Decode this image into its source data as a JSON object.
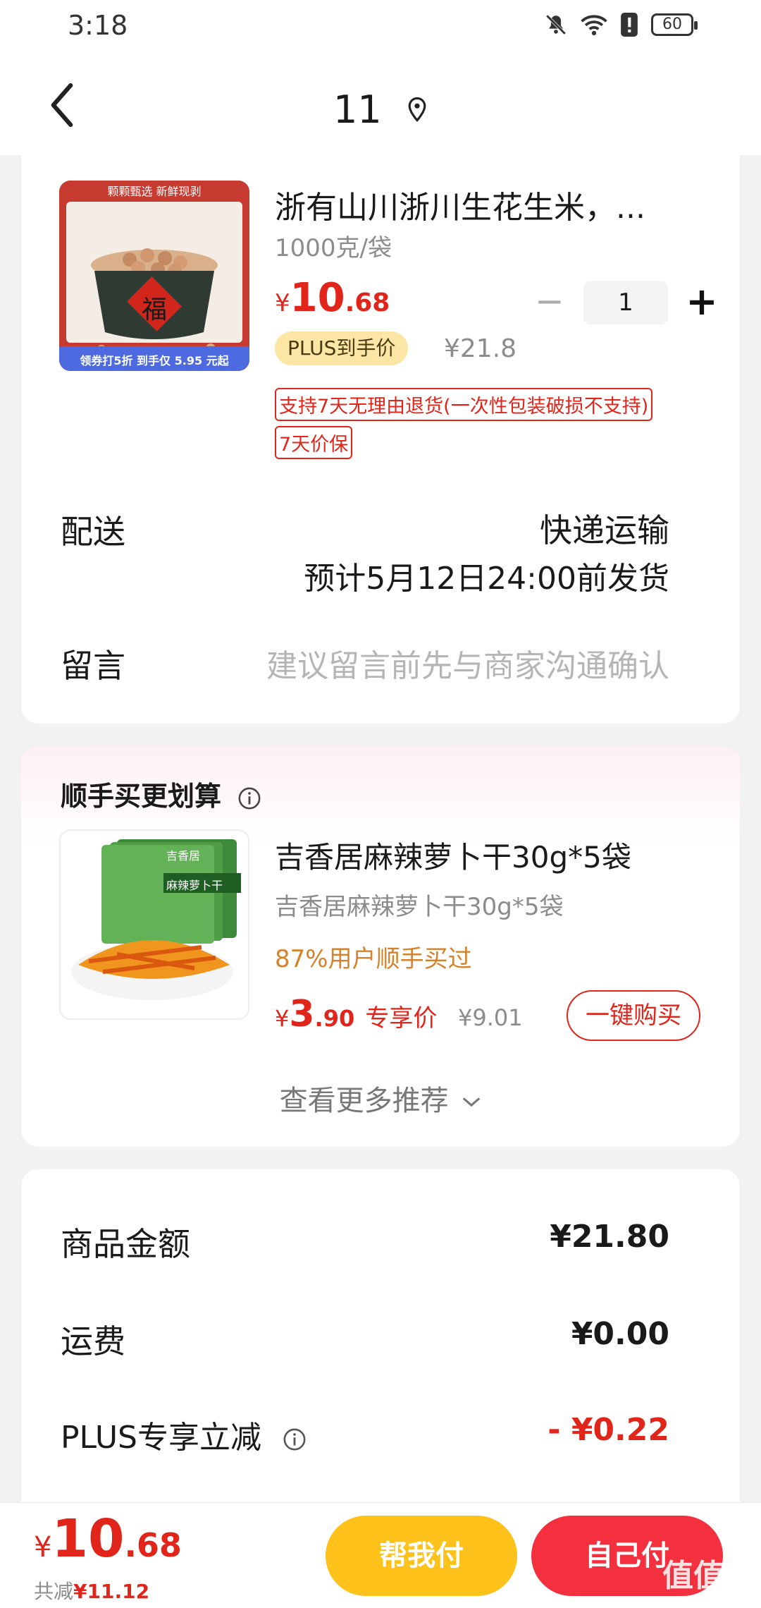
{
  "status_bar": {
    "time": "3:18",
    "battery": "60"
  },
  "header": {
    "title": "11"
  },
  "product": {
    "name": "浙有山川浙川生花生米，...",
    "spec": "1000克/袋",
    "price_symbol": "¥",
    "price_int": "10",
    "price_dec": ".68",
    "plus_badge": "PLUS到手价",
    "original_price": "¥21.8",
    "quantity": "1",
    "tag_return": "支持7天无理由退货(一次性包装破损不支持)",
    "tag_price_protect": "7天价保",
    "image_banner": "颗颗甄选  新鲜现剥",
    "image_promo": "领券打5折  到手仅 5.95 元起",
    "image_fu": "福"
  },
  "delivery": {
    "label": "配送",
    "method": "快递运输",
    "eta": "预计5月12日24:00前发货"
  },
  "message": {
    "label": "留言",
    "placeholder": "建议留言前先与商家沟通确认"
  },
  "recommend": {
    "title": "顺手买更划算",
    "item_name": "吉香居麻辣萝卜干30g*5袋",
    "item_sub": "吉香居麻辣萝卜干30g*5袋",
    "item_stat": "87%用户顺手买过",
    "price_symbol": "¥",
    "price_int": "3",
    "price_dec": ".90",
    "price_tag": "专享价",
    "original_price": "¥9.01",
    "buy_button": "一键购买",
    "more": "查看更多推荐",
    "image_brand": "吉香居",
    "image_label": "麻辣萝卜干"
  },
  "summary": {
    "goods_label": "商品金额",
    "goods_value": "¥21.80",
    "shipping_label": "运费",
    "shipping_value": "¥0.00",
    "plus_label": "PLUS专享立减",
    "plus_value": "- ¥0.22"
  },
  "bottom_bar": {
    "price_symbol": "¥",
    "price_int": "10",
    "price_dec": ".68",
    "saving_label": "共减",
    "saving_value": "¥11.12",
    "help_pay": "帮我付",
    "self_pay": "自己付",
    "watermark": "值值值"
  },
  "colors": {
    "accent_red": "#e1251b",
    "plus_gold": "#fbe6a6",
    "help_pay": "#ffc21a",
    "self_pay": "#f5303e"
  }
}
